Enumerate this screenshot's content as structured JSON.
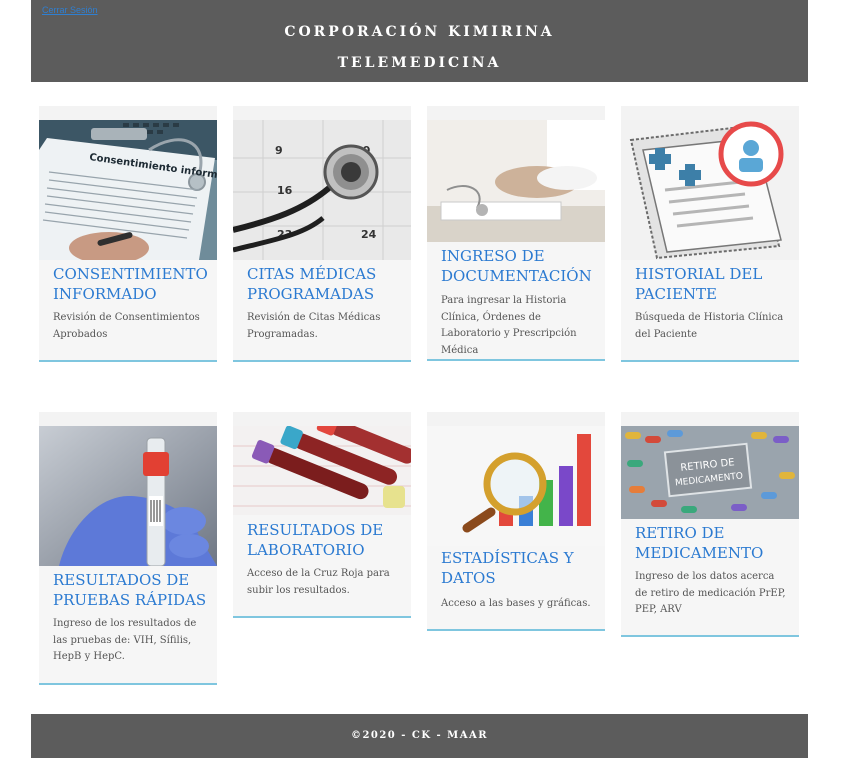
{
  "header": {
    "link": "Cerrar Sesión",
    "title_line1": "CORPORACIÓN KIMIRINA",
    "title_line2": "TELEMEDICINA"
  },
  "cards": [
    {
      "title": "CONSENTIMIENTO INFORMADO",
      "desc": "Revisión de Consentimientos Aprobados",
      "image_text": "Consentimiento informado"
    },
    {
      "title": "CITAS MÉDICAS PROGRAMADAS",
      "desc": "Revisión de Citas Médicas Programadas.",
      "image_text": [
        "9",
        "10",
        "16",
        "23",
        "24"
      ]
    },
    {
      "title": "INGRESO DE DOCUMENTACIÓN",
      "desc": "Para ingresar la Historia Clínica, Órdenes de Laboratorio y Prescripción Médica"
    },
    {
      "title": "HISTORIAL DEL PACIENTE",
      "desc": "Búsqueda de Historia Clínica del Paciente"
    },
    {
      "title": "RESULTADOS DE PRUEBAS RÁPIDAS",
      "desc": "Ingreso de los resultados de las pruebas de: VIH, Sífilis, HepB y HepC."
    },
    {
      "title": "RESULTADOS DE LABORATORIO",
      "desc": "Acceso de la Cruz Roja para subir los resultados."
    },
    {
      "title": "ESTADÍSTICAS Y DATOS",
      "desc": "Acceso a las bases y gráficas."
    },
    {
      "title": "RETIRO DE MEDICAMENTO",
      "desc": "Ingreso de los datos acerca de retiro de medicación PrEP, PEP, ARV",
      "image_text": [
        "RETIRO DE",
        "MEDICAMENTO"
      ]
    }
  ],
  "footer": {
    "text": "©2020 - CK - MAAR"
  },
  "colors": {
    "bar": "#5c5c5c",
    "card_title": "#2b7ad1",
    "card_border": "#7fc6df"
  }
}
